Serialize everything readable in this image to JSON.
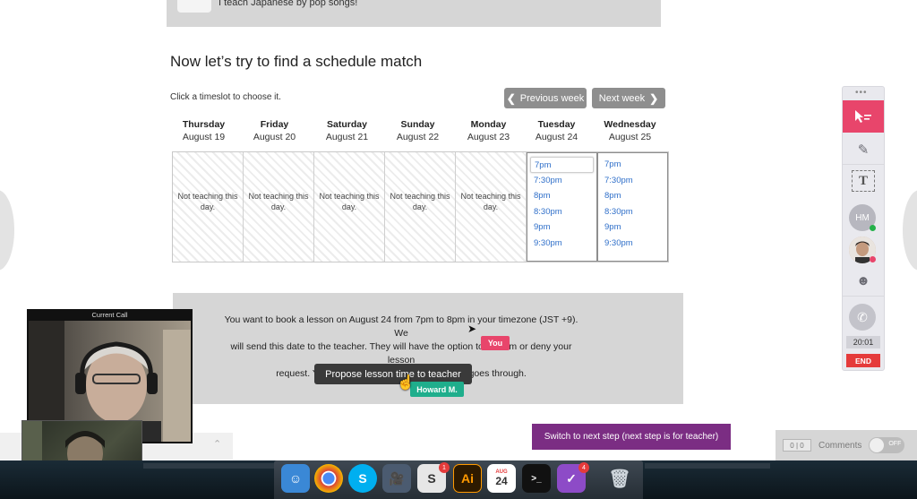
{
  "profile": {
    "tagline": "I teach Japanese by pop songs!"
  },
  "schedule": {
    "heading": "Now let’s try to find a schedule match",
    "hint": "Click a timeslot to choose it.",
    "prev_label": "Previous week",
    "next_label": "Next week",
    "days": [
      {
        "name": "Thursday",
        "date": "August 19",
        "status": "Not teaching this day."
      },
      {
        "name": "Friday",
        "date": "August 20",
        "status": "Not teaching this day."
      },
      {
        "name": "Saturday",
        "date": "August 21",
        "status": "Not teaching this day."
      },
      {
        "name": "Sunday",
        "date": "August 22",
        "status": "Not teaching this day."
      },
      {
        "name": "Monday",
        "date": "August 23",
        "status": "Not teaching this day."
      },
      {
        "name": "Tuesday",
        "date": "August 24",
        "slots": [
          "7pm",
          "7:30pm",
          "8pm",
          "8:30pm",
          "9pm",
          "9:30pm"
        ]
      },
      {
        "name": "Wednesday",
        "date": "August 25",
        "slots": [
          "7pm",
          "7:30pm",
          "8pm",
          "8:30pm",
          "9pm",
          "9:30pm"
        ]
      }
    ]
  },
  "booking": {
    "line1": "You want to book a lesson on August 24 from 7pm to 8pm in your timezone (JST +9). We",
    "line2": "will send this date to the teacher. They will have the option to confirm or deny your lesson",
    "line3": "request. You will only be charged if the lesson goes through.",
    "propose_label": "Propose lesson time to teacher",
    "tag_you": "You",
    "tag_howard": "Howard M."
  },
  "switch_label": "Switch to next step (next step is for teacher)",
  "comments": {
    "count_a": "0",
    "count_b": "0",
    "label": "Comments",
    "toggle": "OFF"
  },
  "toolbar": {
    "initials": "HM",
    "timer": "20:01",
    "end_label": "END"
  },
  "call": {
    "title": "Current Call"
  },
  "dock": {
    "calendar_month": "AUG",
    "calendar_day": "24",
    "badge_s": "1",
    "badge_check": "4",
    "ai_label": "Ai"
  },
  "colors": {
    "accent_pink": "#e8456b",
    "switch_purple": "#7b2d83",
    "slot_blue": "#2f6fc9"
  }
}
